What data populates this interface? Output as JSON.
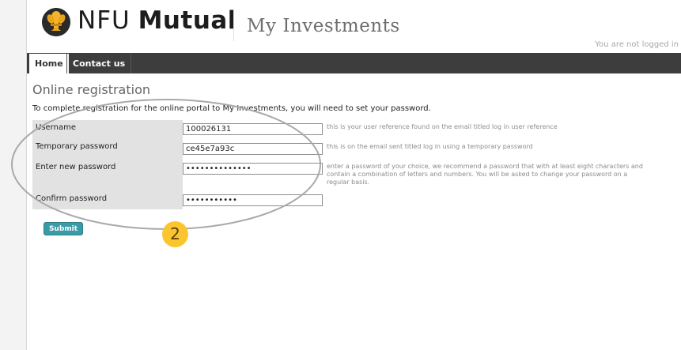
{
  "header": {
    "brand_bold": "Mutual",
    "brand_light": "NFU",
    "subtitle": "My Investments",
    "login_status": "You are not logged in"
  },
  "nav": {
    "home": "Home",
    "contact": "Contact us"
  },
  "main": {
    "title": "Online registration",
    "intro": "To complete registration for the online portal to My Investments, you will need to set your password."
  },
  "form": {
    "username": {
      "label": "Username",
      "value": "100026131",
      "hint": "this is your user reference found on the email titled log in user reference"
    },
    "temp_password": {
      "label": "Temporary password",
      "value": "ce45e7a93c",
      "hint": "this is on the email sent titled log in using a temporary password"
    },
    "new_password": {
      "label": "Enter new password",
      "value": "••••••••••••••",
      "hint": "enter a password of your choice, we recommend a password that with at least eight characters and contain a combination of letters and numbers. You will be asked to change your password on a regular basis."
    },
    "confirm_password": {
      "label": "Confirm password",
      "value": "•••••••••••"
    },
    "submit_label": "Submit"
  },
  "annotation": {
    "step_number": "2"
  },
  "colors": {
    "nav_bg": "#3d3d3d",
    "label_bg": "#e2e2e2",
    "submit_bg": "#3a9aa6",
    "badge_bg": "#fbc52f"
  },
  "icons": {
    "logo": "wheat-sheaf-logo-icon"
  }
}
